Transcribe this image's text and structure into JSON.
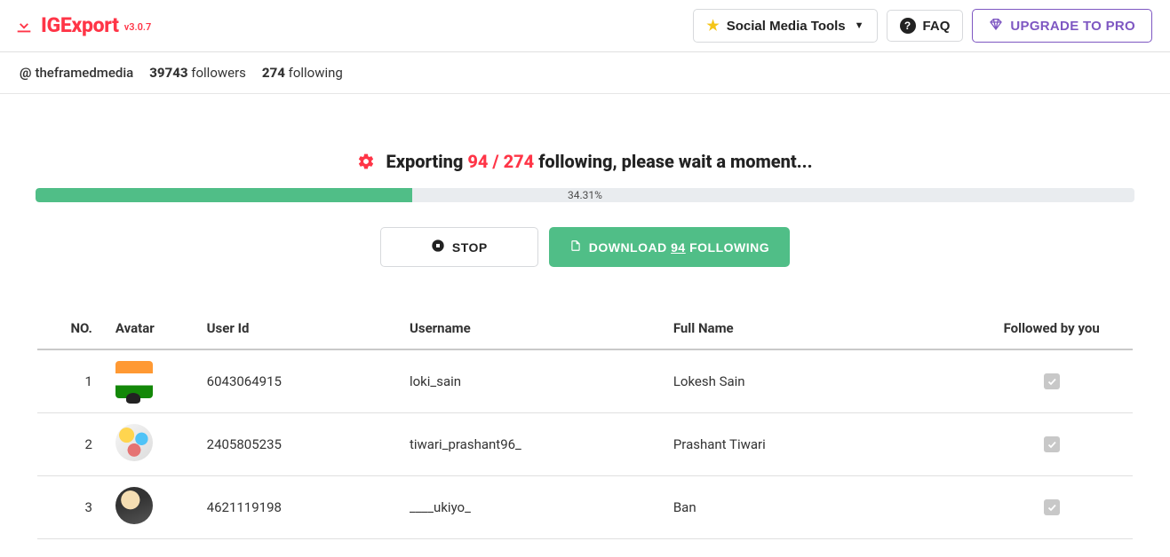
{
  "brand": {
    "name": "IGExport",
    "version": "v3.0.7"
  },
  "topnav": {
    "social_tools": "Social Media Tools",
    "faq": "FAQ",
    "upgrade": "UPGRADE TO PRO"
  },
  "account": {
    "at": "@",
    "handle": "theframedmedia",
    "followers_count": "39743",
    "followers_label": "followers",
    "following_count": "274",
    "following_label": "following"
  },
  "export": {
    "prefix": "Exporting",
    "current": "94",
    "sep": "/",
    "total": "274",
    "suffix": "following, please wait a moment..."
  },
  "progress": {
    "percent": 34.31,
    "text": "34.31%"
  },
  "actions": {
    "stop": "STOP",
    "download_prefix": "DOWNLOAD",
    "download_count": "94",
    "download_suffix": "FOLLOWING"
  },
  "table": {
    "headers": {
      "no": "NO.",
      "avatar": "Avatar",
      "userid": "User Id",
      "username": "Username",
      "fullname": "Full Name",
      "followed": "Followed by you"
    },
    "rows": [
      {
        "no": "1",
        "avatar_class": "avatar-flag",
        "userid": "6043064915",
        "username": "loki_sain",
        "fullname": "Lokesh Sain",
        "followed": true
      },
      {
        "no": "2",
        "avatar_class": "avatar-colorful",
        "userid": "2405805235",
        "username": "tiwari_prashant96_",
        "fullname": "Prashant Tiwari",
        "followed": true
      },
      {
        "no": "3",
        "avatar_class": "avatar-person",
        "userid": "4621119198",
        "username": "____ukiyo_",
        "fullname": "Ban",
        "followed": true
      }
    ]
  }
}
